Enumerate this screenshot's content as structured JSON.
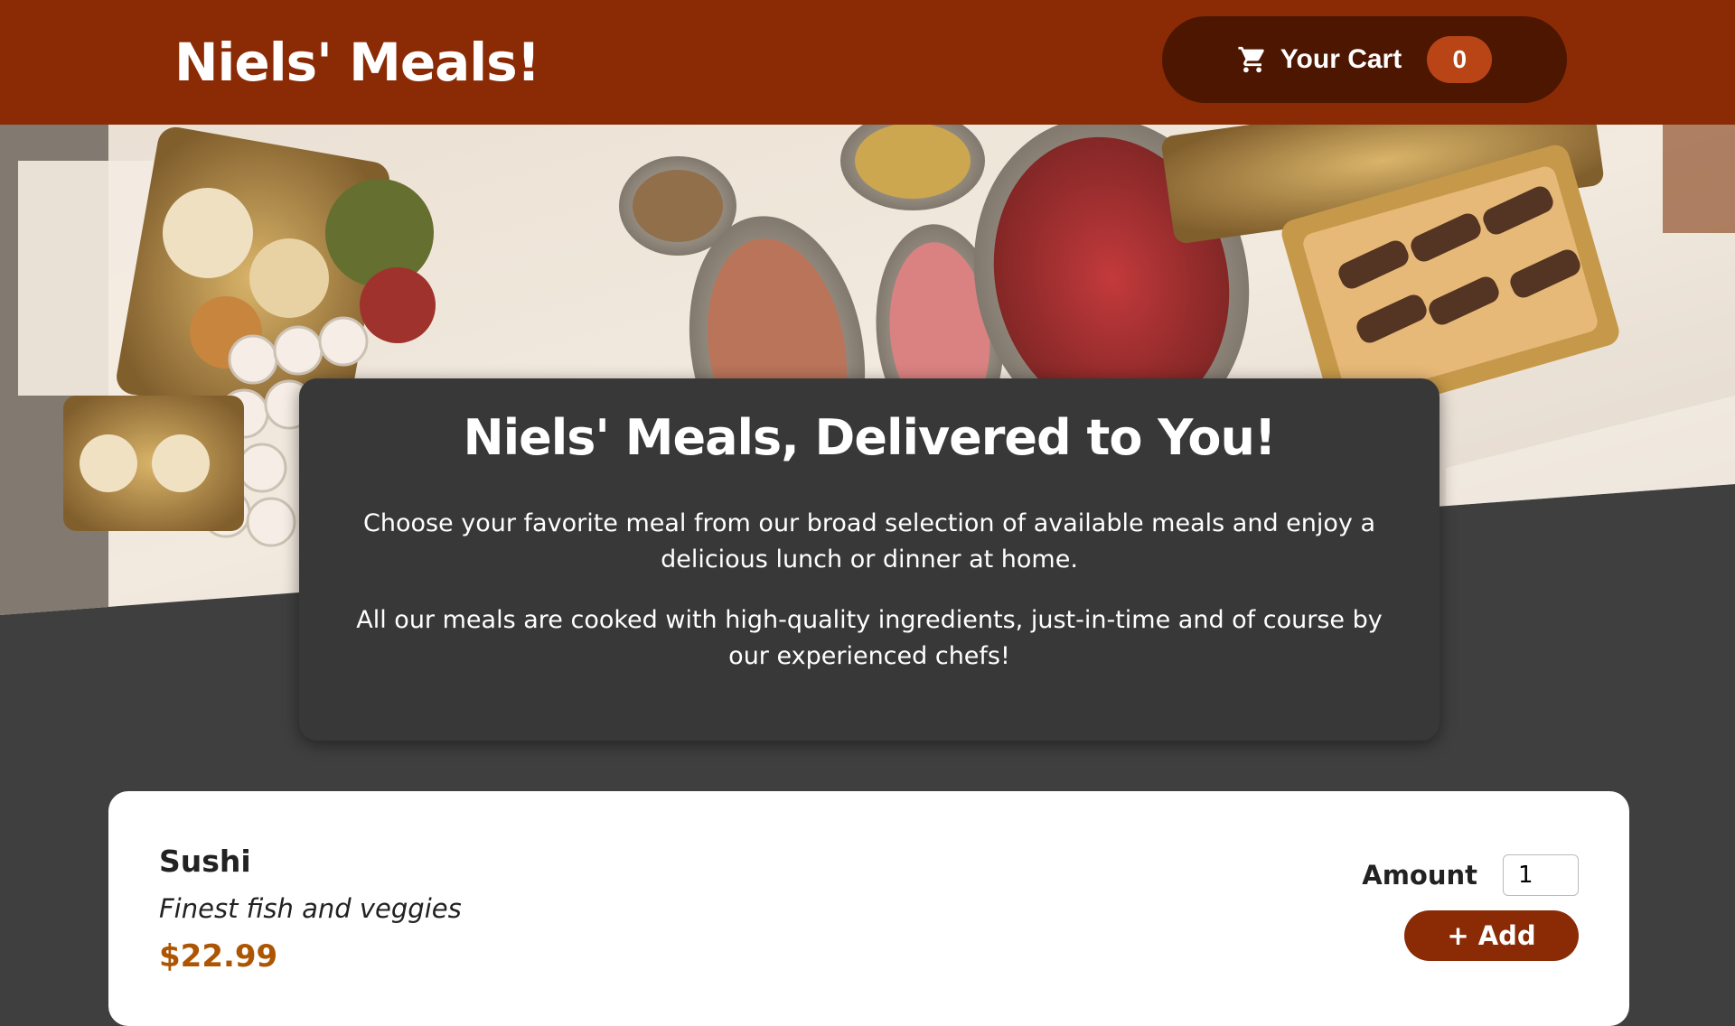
{
  "header": {
    "title": "Niels' Meals!",
    "cart": {
      "icon": "cart-icon",
      "label": "Your Cart",
      "count": "0"
    }
  },
  "hero": {
    "image": "catering-buffet-photo"
  },
  "summary": {
    "heading": "Niels' Meals, Delivered to You!",
    "paragraph1": "Choose your favorite meal from our broad selection of available meals and enjoy a delicious lunch or dinner at home.",
    "paragraph2": "All our meals are cooked with high-quality ingredients, just-in-time and of course by our experienced chefs!"
  },
  "meals": [
    {
      "name": "Sushi",
      "description": "Finest fish and veggies",
      "price": "$22.99",
      "amount_label": "Amount",
      "amount_value": "1",
      "add_label": "+ Add"
    }
  ],
  "colors": {
    "header_bg": "#8a2b06",
    "cart_bg": "#4d1601",
    "badge_bg": "#b94517",
    "page_bg": "#3f3f3f",
    "price": "#ad5502"
  }
}
